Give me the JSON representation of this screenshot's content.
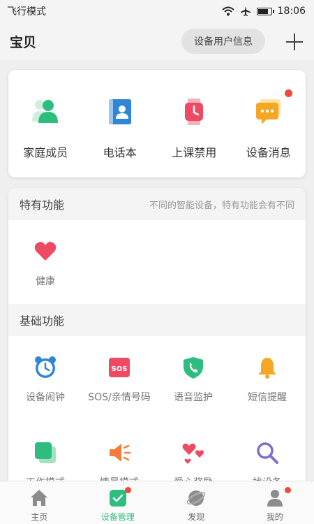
{
  "status_bar": {
    "mode": "飞行模式",
    "time": "18:06"
  },
  "header": {
    "title": "宝贝",
    "info_button": "设备用户信息"
  },
  "top_items": [
    {
      "label": "家庭成员",
      "icon": "family-members-icon"
    },
    {
      "label": "电话本",
      "icon": "phonebook-icon"
    },
    {
      "label": "上课禁用",
      "icon": "class-disable-icon"
    },
    {
      "label": "设备消息",
      "icon": "device-message-icon"
    }
  ],
  "special": {
    "title": "特有功能",
    "note": "不同的智能设备，特有功能会有不同",
    "items": [
      {
        "label": "健康",
        "icon": "heart-icon"
      }
    ]
  },
  "basic": {
    "title": "基础功能",
    "items": [
      {
        "label": "设备闹钟",
        "icon": "alarm-clock-icon"
      },
      {
        "label": "SOS/亲情号码",
        "icon": "sos-icon"
      },
      {
        "label": "语音监护",
        "icon": "voice-monitor-icon"
      },
      {
        "label": "短信提醒",
        "icon": "bell-icon"
      },
      {
        "label": "工作模式",
        "icon": "work-mode-icon"
      },
      {
        "label": "情景模式",
        "icon": "speaker-icon"
      },
      {
        "label": "爱心奖励",
        "icon": "hearts-reward-icon"
      },
      {
        "label": "找设备",
        "icon": "search-icon"
      }
    ]
  },
  "tabs": [
    {
      "label": "主页",
      "icon": "home-icon"
    },
    {
      "label": "设备管理",
      "icon": "device-manage-icon"
    },
    {
      "label": "发现",
      "icon": "discover-icon"
    },
    {
      "label": "我的",
      "icon": "profile-icon"
    }
  ],
  "colors": {
    "accent": "#2dbd7e",
    "badge": "#ef4a3a"
  }
}
